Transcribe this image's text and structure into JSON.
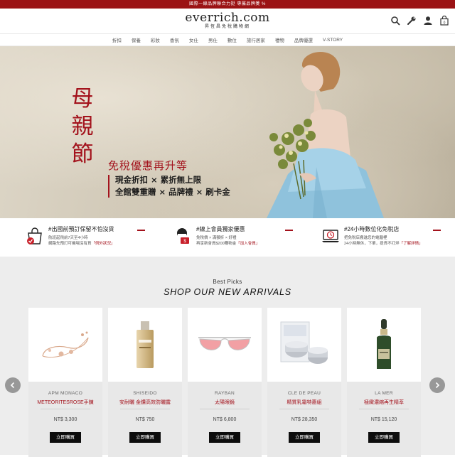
{
  "promo_bar": {
    "text": "國際一線品牌聯合力挺 專屬品牌獎 %"
  },
  "header": {
    "logo": "everrich.com",
    "logo_sub": "昇恆昌免稅購物網",
    "icons": [
      "search-icon",
      "wrench-icon",
      "user-icon",
      "shopping-bag-icon"
    ]
  },
  "nav": [
    "折扣",
    "保養",
    "彩妝",
    "香氛",
    "女仕",
    "男仕",
    "數位",
    "旅行居家",
    "禮物",
    "品牌優選",
    "V-STORY"
  ],
  "hero": {
    "vertical_title": [
      "母",
      "親",
      "節"
    ],
    "subtitle": "免稅優惠再升等",
    "line1": "現金折扣 × 累折無上限",
    "line2": "全館雙重贈 × 品牌禮 × 刷卡金"
  },
  "features": [
    {
      "icon": "shopping-bag-check-icon",
      "title": "#出國前預訂保留不怕沒貨",
      "line1": "航班起飛前7天至4小時",
      "line2": "網路先預訂可機場沒有貨",
      "link": "「例外狀況」"
    },
    {
      "icon": "member-card-icon",
      "title": "#線上會員獨家優惠",
      "line1": "免稅價 × 滿額折 × 好禮",
      "line2": "再享新會員$200購物金",
      "link": "「加入會員」"
    },
    {
      "icon": "laptop-24h-icon",
      "title": "#24小時數位化免稅店",
      "line1": "把免稅店搬進您的電腦裡",
      "line2": "24小時無休，下單，提貨不打烊",
      "link": "「了解詳情」"
    }
  ],
  "picks": {
    "kicker": "Best Picks",
    "headline": "SHOP OUR NEW ARRIVALS",
    "buy_label": "立即購買",
    "products": [
      {
        "brand": "APM MONACO",
        "name": "METEORITESROSE手鍊",
        "price": "NT$ 3,300",
        "icon": "bracelet-icon"
      },
      {
        "brand": "SHISEIDO",
        "name": "安耐曬 金鑽高效防曬露",
        "price": "NT$ 750",
        "icon": "sunscreen-bottle-icon"
      },
      {
        "brand": "RAYBAN",
        "name": "太陽眼鏡",
        "price": "NT$ 6,800",
        "icon": "sunglasses-icon"
      },
      {
        "brand": "CLE DE PEAU",
        "name": "精質乳霜特惠組",
        "price": "NT$ 28,350",
        "icon": "cream-jar-set-icon"
      },
      {
        "brand": "LA MER",
        "name": "極緻濃縮再生精萃",
        "price": "NT$ 15,120",
        "icon": "serum-bottle-icon"
      }
    ]
  },
  "colors": {
    "brand_red": "#9b1214",
    "accent_red": "#a3121c",
    "button": "#0d0d0d"
  }
}
